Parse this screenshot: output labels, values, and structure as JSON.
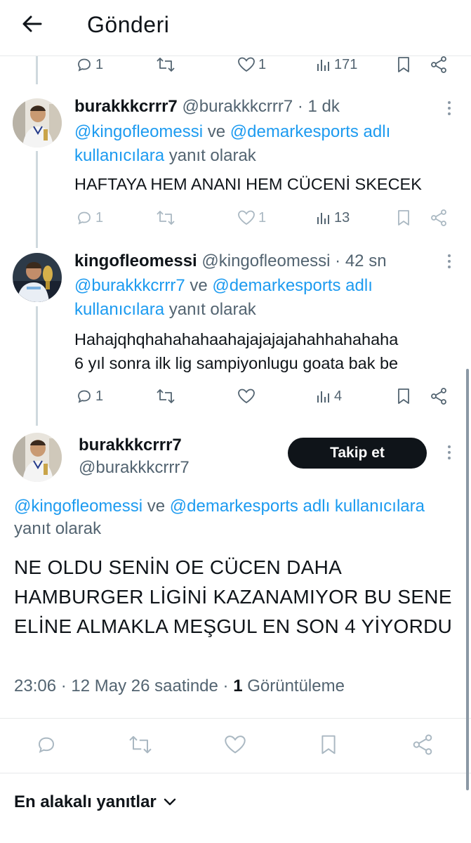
{
  "header": {
    "title": "Gönderi",
    "back_icon": "arrow-left-icon"
  },
  "top_actions": {
    "replies": "1",
    "reposts": "",
    "likes": "1",
    "views": "171"
  },
  "tweets": [
    {
      "name": "burakkkcrrr7",
      "handle": "@burakkkcrrr7",
      "time": " · 1 dk",
      "mention_1": "@kingofleomessi",
      "connector_1": " ve ",
      "mention_2": "@demarkesports adlı kullanıcılara",
      "reply_suffix": " yanıt olarak",
      "text": "HAFTAYA HEM ANANI HEM CÜCENİ SKECEK",
      "replies": "1",
      "reposts": "",
      "likes": "1",
      "views": "13"
    },
    {
      "name": "kingofleomessi",
      "handle": "@kingofleomessi",
      "time": " · 42 sn",
      "mention_1": "@burakkkcrrr7",
      "connector_1": " ve ",
      "mention_2": "@demarkesports adlı kullanıcılara",
      "reply_suffix": " yanıt olarak",
      "text": "Hahajqhqhahahahaahajajajajahahhahahaha\n6 yıl sonra ilk lig sampiyonlugu goata bak be",
      "replies": "1",
      "reposts": "",
      "likes": "",
      "views": "4"
    }
  ],
  "main_tweet": {
    "name": "burakkkcrrr7",
    "handle": "@burakkkcrrr7",
    "follow_label": "Takip et",
    "mention_1": "@kingofleomessi",
    "connector_1": " ve ",
    "mention_2": "@demarkesports adlı kullanıcılara",
    "reply_suffix": "yanıt olarak",
    "text": "NE OLDU SENİN OE CÜCEN DAHA HAMBURGER LİGİNİ KAZANAMIYOR BU SENE ELİNE ALMAKLA MEŞGUL EN SON 4 YİYORDU",
    "time": "23:06 · 12 May 26 saatinde · ",
    "view_count": "1",
    "view_label": " Görüntüleme"
  },
  "sort": {
    "label": "En alakalı yanıtlar"
  },
  "colors": {
    "accent": "#1d9bf0",
    "text": "#0f1419",
    "muted": "#536471",
    "button_bg": "#0f1419"
  }
}
